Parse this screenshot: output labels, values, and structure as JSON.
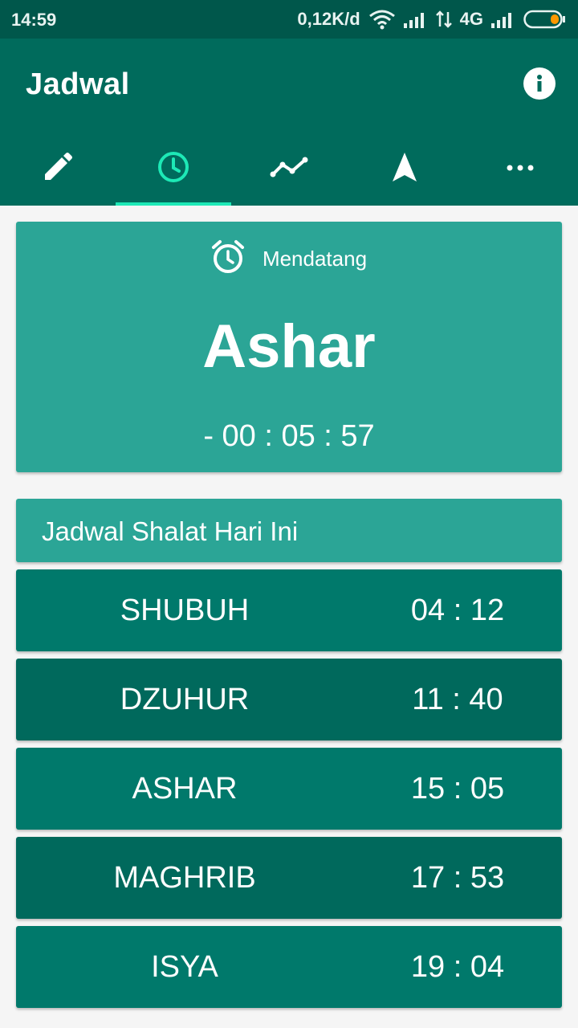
{
  "status_bar": {
    "time": "14:59",
    "speed": "0,12K/d",
    "network": "4G"
  },
  "app_bar": {
    "title": "Jadwal",
    "info_icon": "info-icon"
  },
  "tabs": [
    {
      "icon": "pencil-icon",
      "selected": false
    },
    {
      "icon": "clock-icon",
      "selected": true
    },
    {
      "icon": "trend-icon",
      "selected": false
    },
    {
      "icon": "navigation-arrow-icon",
      "selected": false
    },
    {
      "icon": "more-icon",
      "selected": false
    }
  ],
  "upcoming": {
    "label": "Mendatang",
    "prayer": "Ashar",
    "countdown": "- 00 : 05 : 57"
  },
  "schedule": {
    "title": "Jadwal Shalat Hari Ini",
    "rows": [
      {
        "name": "SHUBUH",
        "time": "04 : 12"
      },
      {
        "name": "DZUHUR",
        "time": "11 : 40"
      },
      {
        "name": "ASHAR",
        "time": "15 : 05"
      },
      {
        "name": "MAGHRIB",
        "time": "17 : 53"
      },
      {
        "name": "ISYA",
        "time": "19 : 04"
      }
    ]
  },
  "colors": {
    "primary": "#006b5c",
    "primary_dark": "#00574b",
    "accent": "#1de9b6",
    "card": "#2ba596",
    "row_light": "#00796b",
    "row_dark": "#00695c"
  }
}
